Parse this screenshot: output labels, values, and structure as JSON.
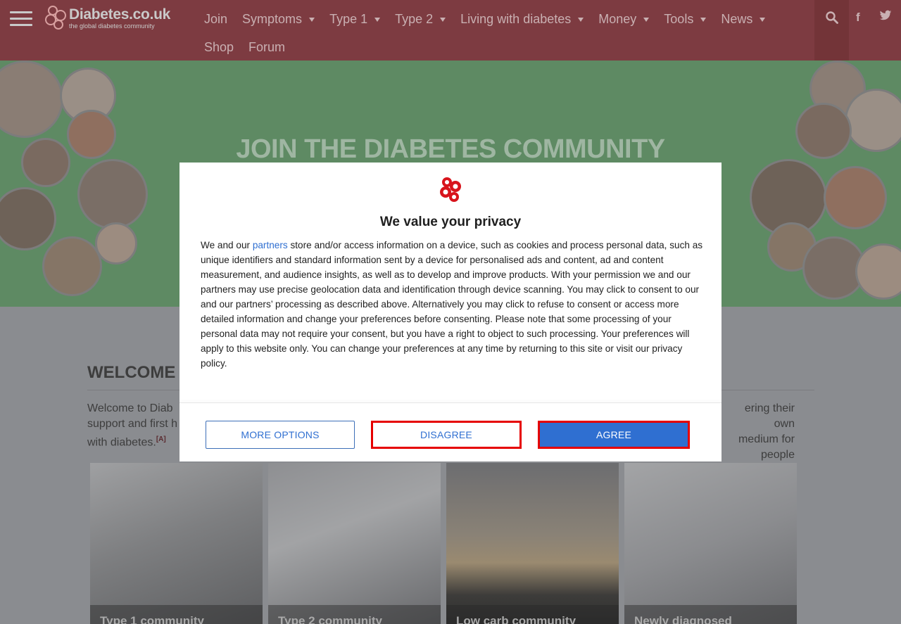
{
  "site": {
    "logo_name": "Diabetes.co.uk",
    "logo_tagline": "the global diabetes community"
  },
  "nav": {
    "row1": [
      {
        "label": "Join",
        "has_dropdown": false
      },
      {
        "label": "Symptoms",
        "has_dropdown": true
      },
      {
        "label": "Type 1",
        "has_dropdown": true
      },
      {
        "label": "Type 2",
        "has_dropdown": true
      },
      {
        "label": "Living with diabetes",
        "has_dropdown": true
      },
      {
        "label": "Money",
        "has_dropdown": true
      },
      {
        "label": "Tools",
        "has_dropdown": true
      },
      {
        "label": "News",
        "has_dropdown": true
      }
    ],
    "row2": [
      {
        "label": "Shop",
        "has_dropdown": false
      },
      {
        "label": "Forum",
        "has_dropdown": false
      }
    ],
    "icons": [
      "menu-icon",
      "search-icon",
      "facebook-icon",
      "twitter-icon"
    ]
  },
  "hero": {
    "title": "JOIN THE DIABETES COMMUNITY"
  },
  "welcome": {
    "heading": "WELCOME",
    "intro_left_line1": "Welcome to Diab",
    "intro_left_line2": "support and first h",
    "intro_line3": "with diabetes.",
    "footnote": "[A]",
    "intro_right_line1": "ering their own",
    "intro_right_line2": "medium for people"
  },
  "cards": [
    {
      "label": "Type 1 community"
    },
    {
      "label": "Type 2 community"
    },
    {
      "label": "Low carb community"
    },
    {
      "label": "Newly diagnosed"
    }
  ],
  "consent": {
    "title": "We value your privacy",
    "text_before_link": "We and our ",
    "link_text": "partners",
    "text_after_link": " store and/or access information on a device, such as cookies and process personal data, such as unique identifiers and standard information sent by a device for personalised ads and content, ad and content measurement, and audience insights, as well as to develop and improve products. With your permission we and our partners may use precise geolocation data and identification through device scanning. You may click to consent to our and our partners’ processing as described above. Alternatively you may click to refuse to consent or access more detailed information and change your preferences before consenting. Please note that some processing of your personal data may not require your consent, but you have a right to object to such processing. Your preferences will apply to this website only. You can change your preferences at any time by returning to this site or visit our privacy policy.",
    "buttons": {
      "more_options": "MORE OPTIONS",
      "disagree": "DISAGREE",
      "agree": "AGREE"
    }
  },
  "colors": {
    "header_bg": "#7d3b41",
    "hero_bg": "#5e8a63",
    "consent_accent": "#2f6fd1",
    "highlight_border": "#e60000"
  }
}
